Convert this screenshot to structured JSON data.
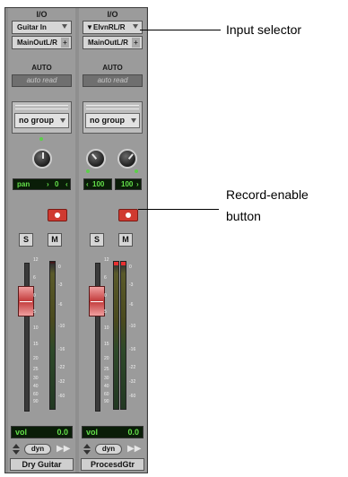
{
  "callouts": {
    "input_selector": "Input selector",
    "record_enable": "Record-enable",
    "record_enable_2": "button"
  },
  "strips": [
    {
      "io_label": "I/O",
      "input": "Guitar In",
      "output": "MainOutL/R",
      "automation_label": "AUTO",
      "automation_mode": "auto read",
      "group": "no group",
      "pan": {
        "label": "pan",
        "value": "0"
      },
      "solo": "S",
      "mute": "M",
      "scale_left": [
        "12",
        "6",
        "0",
        "5",
        "10",
        "15",
        "20",
        "25",
        "30",
        "40",
        "60",
        "90"
      ],
      "scale_right": [
        "0",
        "-3",
        "-6",
        "-10",
        "-16",
        "-22",
        "-32",
        "-60"
      ],
      "volume": {
        "label": "vol",
        "value": "0.0"
      },
      "dyn": "dyn",
      "name": "Dry Guitar"
    },
    {
      "io_label": "I/O",
      "input": "ElvnRL/R",
      "output": "MainOutL/R",
      "automation_label": "AUTO",
      "automation_mode": "auto read",
      "group": "no group",
      "pan_left": "100",
      "pan_right": "100",
      "solo": "S",
      "mute": "M",
      "scale_left": [
        "12",
        "6",
        "0",
        "5",
        "10",
        "15",
        "20",
        "25",
        "30",
        "40",
        "60",
        "90"
      ],
      "scale_right": [
        "0",
        "-3",
        "-6",
        "-10",
        "-16",
        "-22",
        "-32",
        "-60"
      ],
      "volume": {
        "label": "vol",
        "value": "0.0"
      },
      "dyn": "dyn",
      "name": "ProcesdGtr"
    }
  ],
  "colors": {
    "record": "#d03a30",
    "display_text": "#64e04a",
    "display_bg": "#0a1d08"
  }
}
